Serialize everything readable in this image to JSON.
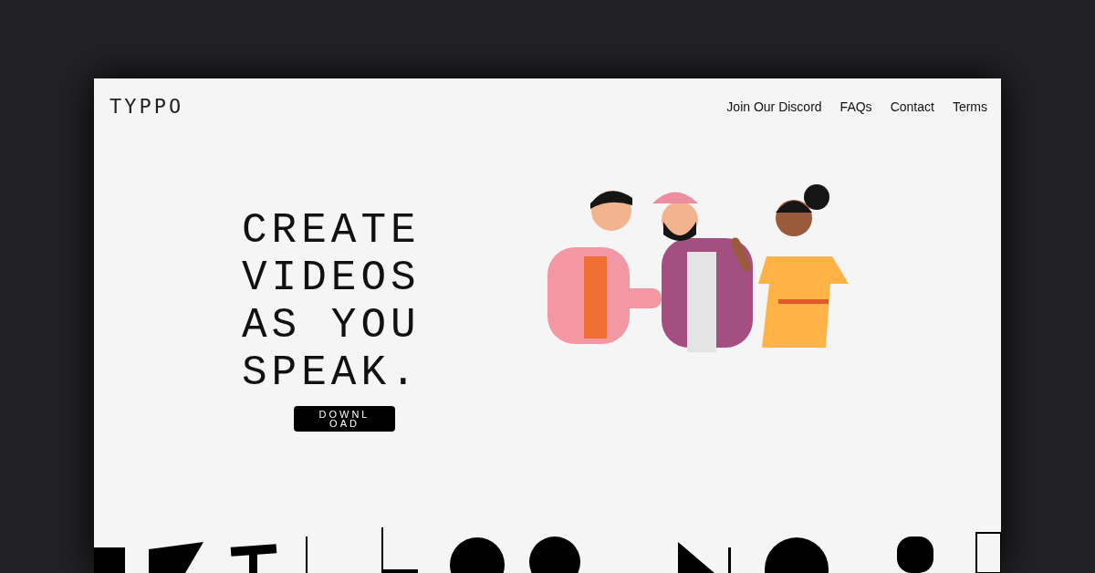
{
  "logo": "TYP**PO**",
  "nav": [
    {
      "label": "Join Our Discord"
    },
    {
      "label": "FAQs"
    },
    {
      "label": "Contact"
    },
    {
      "label": "Terms"
    }
  ],
  "hero": {
    "headline": [
      "CREATE",
      "VIDEOS",
      "AS YOU",
      "SPEAK."
    ],
    "button": "DOWNLOAD"
  }
}
